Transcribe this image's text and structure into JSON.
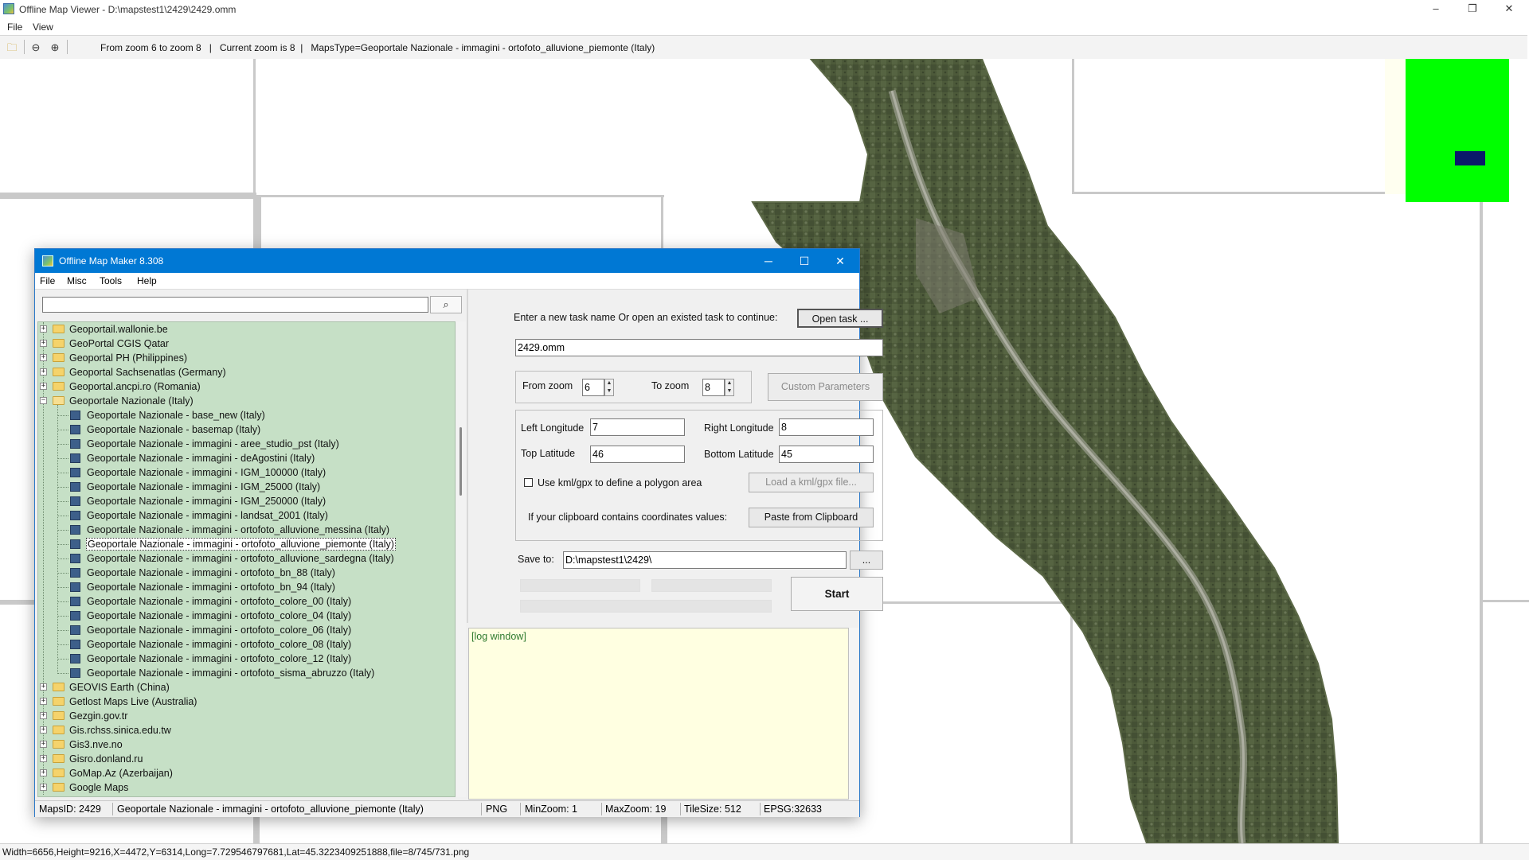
{
  "window": {
    "title": "Offline Map Viewer - D:\\mapstest1\\2429\\2429.omm",
    "minimize": "–",
    "restore": "❐",
    "close": "✕"
  },
  "menu": {
    "file": "File",
    "view": "View"
  },
  "toolbar": {
    "open_icon": "folder-open-icon",
    "zoom_out_icon": "zoom-out-icon",
    "zoom_in_icon": "zoom-in-icon",
    "zoom_range": "From zoom 6 to zoom 8",
    "current_zoom": "Current zoom is 8",
    "maps_type": "MapsType=Geoportale Nazionale - immagini - ortofoto_alluvione_piemonte (Italy)"
  },
  "statusbar": {
    "text": "Width=6656,Height=9216,X=4472,Y=6314,Long=7.729546797681,Lat=45.3223409251888,file=8/745/731.png"
  },
  "dialog": {
    "title": "Offline Map Maker 8.308",
    "minimize": "─",
    "maximize": "☐",
    "close": "✕",
    "menu": {
      "file": "File",
      "misc": "Misc",
      "tools": "Tools",
      "help": "Help"
    },
    "search": {
      "value": "",
      "button_icon": "search-icon"
    },
    "tree": [
      {
        "label": "Geoportail.wallonie.be",
        "type": "folder",
        "expanded": false
      },
      {
        "label": "GeoPortal CGIS Qatar",
        "type": "folder",
        "expanded": false
      },
      {
        "label": "Geoportal PH (Philippines)",
        "type": "folder",
        "expanded": false
      },
      {
        "label": "Geoportal Sachsenatlas (Germany)",
        "type": "folder",
        "expanded": false
      },
      {
        "label": "Geoportal.ancpi.ro (Romania)",
        "type": "folder",
        "expanded": false
      },
      {
        "label": "Geoportale Nazionale (Italy)",
        "type": "folder",
        "expanded": true
      },
      {
        "label": "Geoportale Nazionale - base_new (Italy)",
        "type": "map"
      },
      {
        "label": "Geoportale Nazionale - basemap (Italy)",
        "type": "map"
      },
      {
        "label": "Geoportale Nazionale - immagini - aree_studio_pst (Italy)",
        "type": "map"
      },
      {
        "label": "Geoportale Nazionale - immagini - deAgostini (Italy)",
        "type": "map"
      },
      {
        "label": "Geoportale Nazionale - immagini - IGM_100000 (Italy)",
        "type": "map"
      },
      {
        "label": "Geoportale Nazionale - immagini - IGM_25000 (Italy)",
        "type": "map"
      },
      {
        "label": "Geoportale Nazionale - immagini - IGM_250000 (Italy)",
        "type": "map"
      },
      {
        "label": "Geoportale Nazionale - immagini - landsat_2001 (Italy)",
        "type": "map"
      },
      {
        "label": "Geoportale Nazionale - immagini - ortofoto_alluvione_messina (Italy)",
        "type": "map"
      },
      {
        "label": "Geoportale Nazionale - immagini - ortofoto_alluvione_piemonte (Italy)",
        "type": "map",
        "selected": true
      },
      {
        "label": "Geoportale Nazionale - immagini - ortofoto_alluvione_sardegna (Italy)",
        "type": "map"
      },
      {
        "label": "Geoportale Nazionale - immagini - ortofoto_bn_88 (Italy)",
        "type": "map"
      },
      {
        "label": "Geoportale Nazionale - immagini - ortofoto_bn_94 (Italy)",
        "type": "map"
      },
      {
        "label": "Geoportale Nazionale - immagini - ortofoto_colore_00 (Italy)",
        "type": "map"
      },
      {
        "label": "Geoportale Nazionale - immagini - ortofoto_colore_04 (Italy)",
        "type": "map"
      },
      {
        "label": "Geoportale Nazionale - immagini - ortofoto_colore_06 (Italy)",
        "type": "map"
      },
      {
        "label": "Geoportale Nazionale - immagini - ortofoto_colore_08 (Italy)",
        "type": "map"
      },
      {
        "label": "Geoportale Nazionale - immagini - ortofoto_colore_12 (Italy)",
        "type": "map"
      },
      {
        "label": "Geoportale Nazionale - immagini - ortofoto_sisma_abruzzo (Italy)",
        "type": "map"
      },
      {
        "label": "GEOVIS Earth (China)",
        "type": "folder",
        "expanded": false
      },
      {
        "label": "Getlost Maps Live (Australia)",
        "type": "folder",
        "expanded": false
      },
      {
        "label": "Gezgin.gov.tr",
        "type": "folder",
        "expanded": false
      },
      {
        "label": "Gis.rchss.sinica.edu.tw",
        "type": "folder",
        "expanded": false
      },
      {
        "label": "Gis3.nve.no",
        "type": "folder",
        "expanded": false
      },
      {
        "label": "Gisro.donland.ru",
        "type": "folder",
        "expanded": false
      },
      {
        "label": "GoMap.Az (Azerbaijan)",
        "type": "folder",
        "expanded": false
      },
      {
        "label": "Google Maps",
        "type": "folder",
        "expanded": false
      }
    ],
    "task_prompt": "Enter a new task name Or open an existed task to continue:",
    "open_task": "Open task ...",
    "task_name": "2429.omm",
    "from_zoom_label": "From zoom",
    "from_zoom": "6",
    "to_zoom_label": "To zoom",
    "to_zoom": "8",
    "custom_params": "Custom Parameters",
    "left_lon_label": "Left Longitude",
    "left_lon": "7",
    "right_lon_label": "Right Longitude",
    "right_lon": "8",
    "top_lat_label": "Top Latitude",
    "top_lat": "46",
    "bottom_lat_label": "Bottom Latitude",
    "bottom_lat": "45",
    "kml_label": "Use kml/gpx to define a polygon area",
    "load_kml": "Load a kml/gpx file...",
    "clipboard_label": "If your clipboard contains coordinates values:",
    "paste_clipboard": "Paste from Clipboard",
    "save_to_label": "Save to:",
    "save_to": "D:\\mapstest1\\2429\\",
    "browse": "...",
    "start": "Start",
    "log": "[log window]",
    "status": {
      "maps_id": "MapsID: 2429",
      "name": "Geoportale Nazionale - immagini - ortofoto_alluvione_piemonte (Italy)",
      "format": "PNG",
      "min_zoom": "MinZoom: 1",
      "max_zoom": "MaxZoom: 19",
      "tile_size": "TileSize: 512",
      "epsg": "EPSG:32633"
    }
  }
}
